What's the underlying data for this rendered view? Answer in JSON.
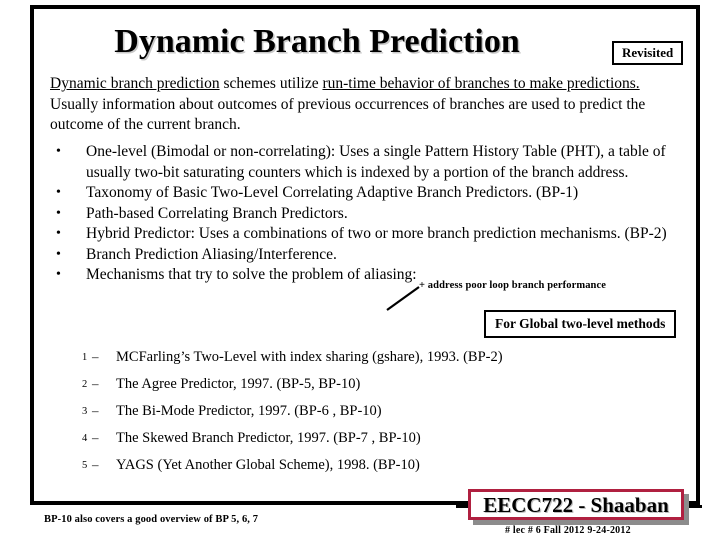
{
  "slide": {
    "title": "Dynamic Branch Prediction",
    "revisited_badge": "Revisited"
  },
  "intro": {
    "seg1": "Dynamic branch prediction",
    "seg2": " schemes utilize ",
    "seg3": "run-time behavior of branches to make predictions.",
    "seg4": "  Usually information about outcomes of previous occurrences of branches are used to predict the outcome of the current branch."
  },
  "bullets": [
    {
      "marker": "•",
      "text": "One-level (Bimodal or non-correlating):  Uses a single Pattern History Table (PHT), a table of usually two-bit saturating counters which is indexed by a portion of the branch address."
    },
    {
      "marker": "•",
      "text": "Taxonomy of Basic Two-Level Correlating Adaptive Branch Predictors. (BP-1)"
    },
    {
      "marker": "•",
      "text": "Path-based Correlating Branch Predictors."
    },
    {
      "marker": "•",
      "text": "Hybrid Predictor:  Uses a combinations of two or more  branch prediction mechanisms.  (BP-2)"
    },
    {
      "marker": "•",
      "text": "Branch Prediction Aliasing/Interference."
    },
    {
      "marker": "•",
      "text": "Mechanisms that try to solve the problem of aliasing:"
    }
  ],
  "numbered": [
    {
      "num": "1",
      "dash": "–",
      "text": "MCFarling’s Two-Level with index sharing (gshare), 1993.  (BP-2)"
    },
    {
      "num": "2",
      "dash": "–",
      "text": "The Agree Predictor, 1997.  (BP-5,  BP-10)"
    },
    {
      "num": "3",
      "dash": "–",
      "text": "The Bi-Mode Predictor, 1997.  (BP-6 ,  BP-10)"
    },
    {
      "num": "4",
      "dash": "–",
      "text": "The Skewed Branch Predictor, 1997.  (BP-7 ,  BP-10)"
    },
    {
      "num": "5",
      "dash": "–",
      "text": "YAGS (Yet Another Global Scheme), 1998.  (BP-10)"
    }
  ],
  "annotations": {
    "loop_note": "+ address poor loop branch performance",
    "global_box": "For Global two-level methods"
  },
  "footer": {
    "note": "BP-10 also covers a good overview of BP 5, 6, 7",
    "brand": "EECC722 - Shaaban",
    "meta": "#  lec # 6   Fall 2012   9-24-2012"
  },
  "colors": {
    "brand_border": "#b02040",
    "brand_shadow": "#8c8c8c",
    "frame": "#000000",
    "text": "#000000"
  }
}
